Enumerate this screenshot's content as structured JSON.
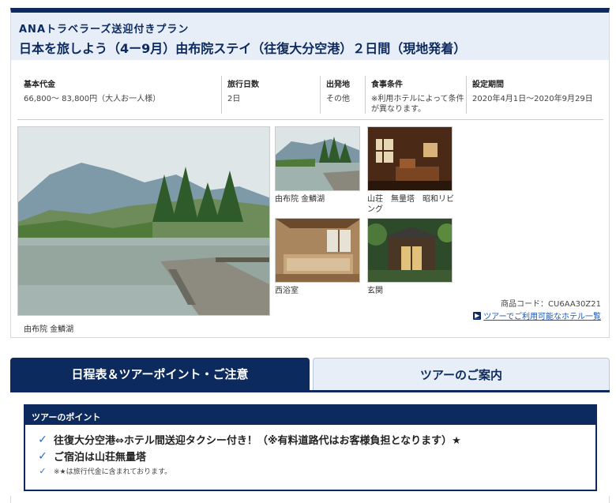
{
  "header": {
    "subtitle": "ANAトラベラーズ送迎付きプラン",
    "title": "日本を旅しよう（4ー9月）由布院ステイ（往復大分空港）２日間（現地発着）"
  },
  "info": {
    "price": {
      "label": "基本代金",
      "value": "66,800～ 83,800円（大人お一人様）"
    },
    "days": {
      "label": "旅行日数",
      "value": "2日"
    },
    "departure": {
      "label": "出発地",
      "value": "その他"
    },
    "meal": {
      "label": "食事条件",
      "value": "※利用ホテルによって条件が異なります。"
    },
    "period": {
      "label": "設定期間",
      "value": "2020年4月1日～2020年9月29日"
    }
  },
  "photos": {
    "main_caption": "由布院 金鱗湖",
    "thumbs": [
      {
        "caption": "由布院 金鱗湖"
      },
      {
        "caption": "山荘　無量塔　昭和リビング"
      },
      {
        "caption": "西浴室"
      },
      {
        "caption": "玄関"
      }
    ]
  },
  "product_code": "商品コード：CU6AA30Z21",
  "hotel_link": "ツアーでご利用可能なホテル一覧",
  "tabs": [
    {
      "label": "日程表＆ツアーポイント・ご注意"
    },
    {
      "label": "ツアーのご案内"
    }
  ],
  "points": {
    "heading": "ツアーのポイント",
    "items": [
      "往復大分空港⇔ホテル間送迎タクシー付き！（※有料道路代はお客様負担となります）★",
      "ご宿泊は山荘無量塔",
      "※★は旅行代金に含まれております。"
    ]
  },
  "colors": {
    "navy": "#0c2a5e",
    "light_blue": "#e7eef8",
    "link": "#1a56b8",
    "check": "#1f6fd1"
  },
  "icons": {
    "check": "check-icon",
    "arrow": "arrow-right-icon"
  }
}
